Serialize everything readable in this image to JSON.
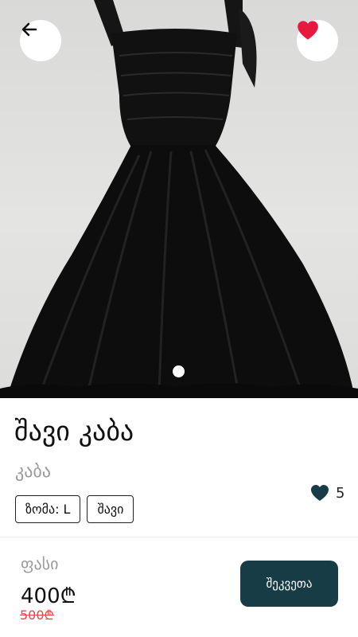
{
  "product": {
    "title": "შავი კაბა",
    "category": "კაბა",
    "tags": [
      "ზომა: L",
      "შავი"
    ],
    "likes": "5",
    "image": {
      "icon": "dress-photo",
      "slide_dots": 1
    }
  },
  "price": {
    "label": "ფასი",
    "current": "400₾",
    "old": "500₾"
  },
  "actions": {
    "order_label": "შეკვეთა",
    "back_icon": "arrow-left-icon",
    "favorite_icon": "heart-icon"
  },
  "colors": {
    "accent_button": "#173c45",
    "favorite": "#e8183f",
    "old_price": "#e5484d",
    "likes_heart": "#173c45"
  }
}
